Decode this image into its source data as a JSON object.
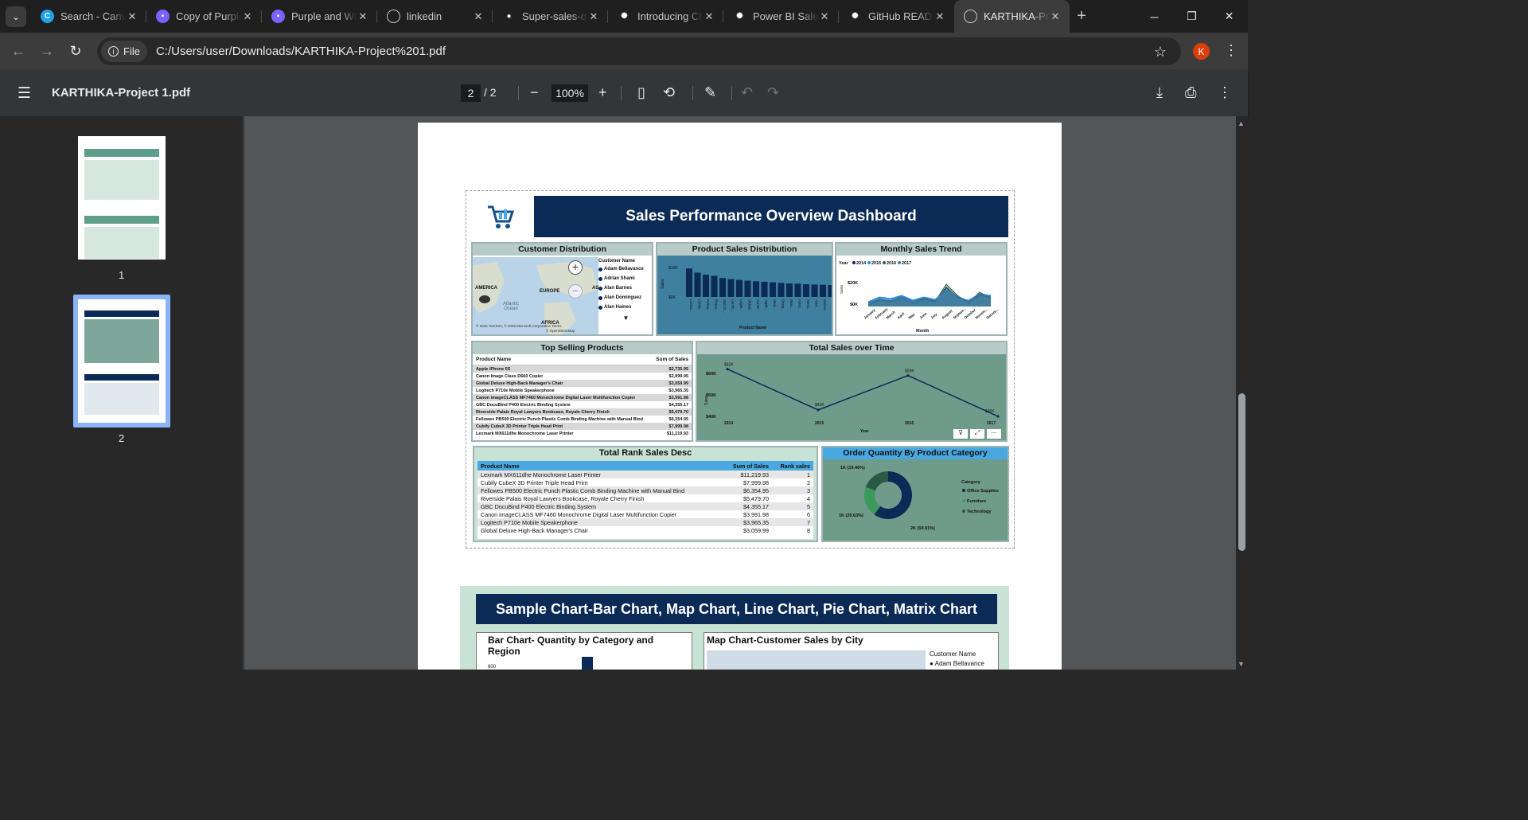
{
  "tabs": [
    {
      "label": "Search - Canva",
      "icon": "canva-icon",
      "color": "#1fa2e8"
    },
    {
      "label": "Copy of Purple",
      "icon": "canva-doc-icon",
      "color": "#7b61ff"
    },
    {
      "label": "Purple and White",
      "icon": "canva-doc-icon",
      "color": "#7b61ff"
    },
    {
      "label": "linkedin",
      "icon": "globe-icon",
      "color": "#5f6368"
    },
    {
      "label": "Super-sales-dashboard",
      "icon": "github-icon",
      "color": "#ffffff"
    },
    {
      "label": "Introducing ChatGPT",
      "icon": "openai-icon",
      "color": "#ffffff"
    },
    {
      "label": "Power BI Sales",
      "icon": "openai-icon",
      "color": "#ffffff"
    },
    {
      "label": "GitHub README",
      "icon": "openai-icon",
      "color": "#ffffff"
    },
    {
      "label": "KARTHIKA-Project",
      "icon": "globe-icon",
      "color": "#5f6368"
    }
  ],
  "address": {
    "chip": "File",
    "url": "C:/Users/user/Downloads/KARTHIKA-Project%201.pdf",
    "avatar": "K"
  },
  "pdf": {
    "filename": "KARTHIKA-Project 1.pdf",
    "page": "2",
    "total": "/  2",
    "zoom": "100%"
  },
  "thumbs": [
    {
      "label": "1"
    },
    {
      "label": "2"
    }
  ],
  "dashboard": {
    "title": "Sales Performance Overview Dashboard",
    "customer": {
      "title": "Customer Distribution",
      "legend_title": "Customer Name",
      "names": [
        "Adam Bellavance",
        "Adrian Shami",
        "Alan Barnes",
        "Alan Dominguez",
        "Alan Haines"
      ],
      "map_labels": [
        "AMERICA",
        "EUROPE",
        "Atlantic Ocean",
        "AFRICA",
        "AS"
      ],
      "credit": "© 2025 TomTom, © 2025 Microsoft Corporation Terms",
      "credit2": "© OpenStreetMap"
    },
    "product_sales": {
      "title": "Product Sales Distribution",
      "ylabel": "Sales",
      "xlabel": "Product Name",
      "ticks": [
        "$10K",
        "$0K"
      ],
      "values": [
        10.5,
        9.0,
        8.2,
        7.8,
        7.0,
        6.6,
        6.3,
        6.0,
        5.8,
        5.6,
        5.4,
        5.2,
        5.0,
        4.9,
        4.7,
        4.6,
        4.5,
        4.4
      ],
      "names": [
        "Lexma...",
        "Cubify...",
        "Fellow...",
        "Rivers...",
        "GBC D...",
        "Canon...",
        "Logite...",
        "Global...",
        "Canon...",
        "Apple...",
        "Hewl...",
        "Sharp...",
        "Bose...",
        "Avery...",
        "Xerox...",
        "Acco...",
        "Samsu...",
        "Ibico..."
      ]
    },
    "monthly": {
      "title": "Monthly Sales Trend",
      "legend_label": "Year",
      "years": [
        "2014",
        "2015",
        "2016",
        "2017"
      ],
      "colors": [
        "#0b2a55",
        "#1a8fe3",
        "#2b5f3a",
        "#3f7fbf"
      ],
      "ticks": [
        "$20K",
        "$0K"
      ],
      "ylabel": "Sales",
      "xlabel": "Month",
      "months": [
        "January",
        "February",
        "March",
        "April",
        "May",
        "June",
        "July",
        "August",
        "Septem...",
        "October",
        "Novem...",
        "Decem..."
      ]
    },
    "top_selling": {
      "title": "Top Selling Products",
      "col1": "Product Name",
      "col2": "Sum of Sales",
      "rows": [
        [
          "Apple iPhone 5S",
          "$2,735.95"
        ],
        [
          "Canon Image Class D660 Copier",
          "$2,999.95"
        ],
        [
          "Global Deluxe High-Back Manager's Chair",
          "$3,059.99"
        ],
        [
          "Logitech P710e Mobile Speakerphone",
          "$3,965.35"
        ],
        [
          "Canon imageCLASS MF7460 Monochrome Digital Laser Multifunction Copier",
          "$3,991.98"
        ],
        [
          "GBC DocuBind P400 Electric Binding System",
          "$4,355.17"
        ],
        [
          "Riverside Palais Royal Lawyers Bookcase, Royale Cherry Finish",
          "$5,479.70"
        ],
        [
          "Fellowes PB500 Electric Punch Plastic Comb Binding Machine with Manual Bind",
          "$6,354.95"
        ],
        [
          "Cubify CubeX 3D Printer Triple Head Print",
          "$7,999.98"
        ],
        [
          "Lexmark MX611dhe Monochrome Laser Printer",
          "$11,219.93"
        ]
      ]
    },
    "over_time": {
      "title": "Total Sales over Time",
      "ticks": [
        "$60K",
        "$50K",
        "$40K"
      ],
      "years": [
        "2014",
        "2015",
        "2016",
        "2017"
      ],
      "values": [
        62,
        43,
        59,
        40
      ],
      "labels": [
        "$62K",
        "$43K",
        "$59K",
        "$40K"
      ],
      "xlabel": "Year",
      "ylabel": "Sales"
    },
    "rank": {
      "title": "Total Rank Sales Desc",
      "col1": "Product Name",
      "col2": "Sum of Sales",
      "col3": "Rank sales",
      "rows": [
        [
          "Lexmark MX611dhe Monochrome Laser Printer",
          "$11,219.93",
          "1"
        ],
        [
          "Cubify CubeX 3D Printer Triple Head Print",
          "$7,999.98",
          "2"
        ],
        [
          "Fellowes PB500 Electric Punch Plastic Comb Binding Machine with Manual Bind",
          "$6,354.95",
          "3"
        ],
        [
          "Riverside Palais Royal Lawyers Bookcase, Royale Cherry Finish",
          "$5,479.70",
          "4"
        ],
        [
          "GBC DocuBind P400 Electric Binding System",
          "$4,355.17",
          "5"
        ],
        [
          "Canon imageCLASS MF7460 Monochrome Digital Laser Multifunction Copier",
          "$3,991.98",
          "6"
        ],
        [
          "Logitech P710e Mobile Speakerphone",
          "$3,965.35",
          "7"
        ],
        [
          "Global Deluxe High-Back Manager's Chair",
          "$3,059.99",
          "8"
        ]
      ]
    },
    "order_qty": {
      "title": "Order Quantity By Product Category",
      "legend_title": "Category",
      "categories": [
        "Office Supplies",
        "Furniture",
        "Technology"
      ],
      "percents": [
        59.91,
        20.63,
        19.46
      ],
      "labels": [
        "2K (59.91%)",
        "1K (20.63%)",
        "1K (19.46%)"
      ],
      "colors": [
        "#0b2a55",
        "#3a9a5b",
        "#2a5a45"
      ]
    }
  },
  "sample": {
    "title": "Sample Chart-Bar Chart, Map Chart, Line Chart, Pie Chart, Matrix Chart",
    "bar_title": "Bar Chart- Quantity by Category and Region",
    "bar_tick": "600",
    "map_title": "Map Chart-Customer Sales by City",
    "map_legend": "Customer Name",
    "map_name": "Adam Bellavance"
  }
}
